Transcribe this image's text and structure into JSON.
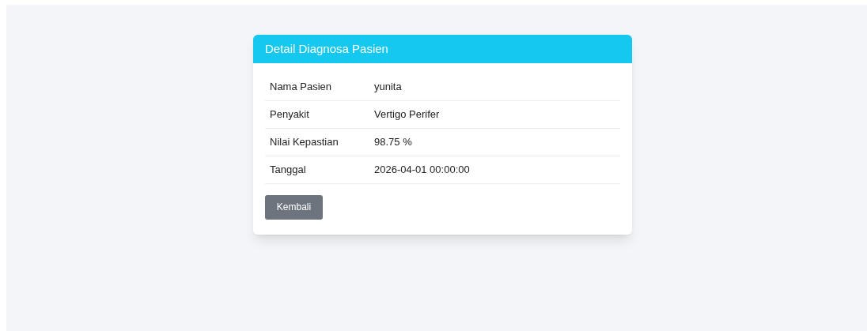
{
  "card": {
    "title": "Detail Diagnosa Pasien",
    "rows": [
      {
        "label": "Nama Pasien",
        "value": "yunita"
      },
      {
        "label": "Penyakit",
        "value": "Vertigo Perifer"
      },
      {
        "label": "Nilai Kepastian",
        "value": "98.75 %"
      },
      {
        "label": "Tanggal",
        "value": "2026-04-01 00:00:00"
      }
    ],
    "button": "Kembali"
  }
}
